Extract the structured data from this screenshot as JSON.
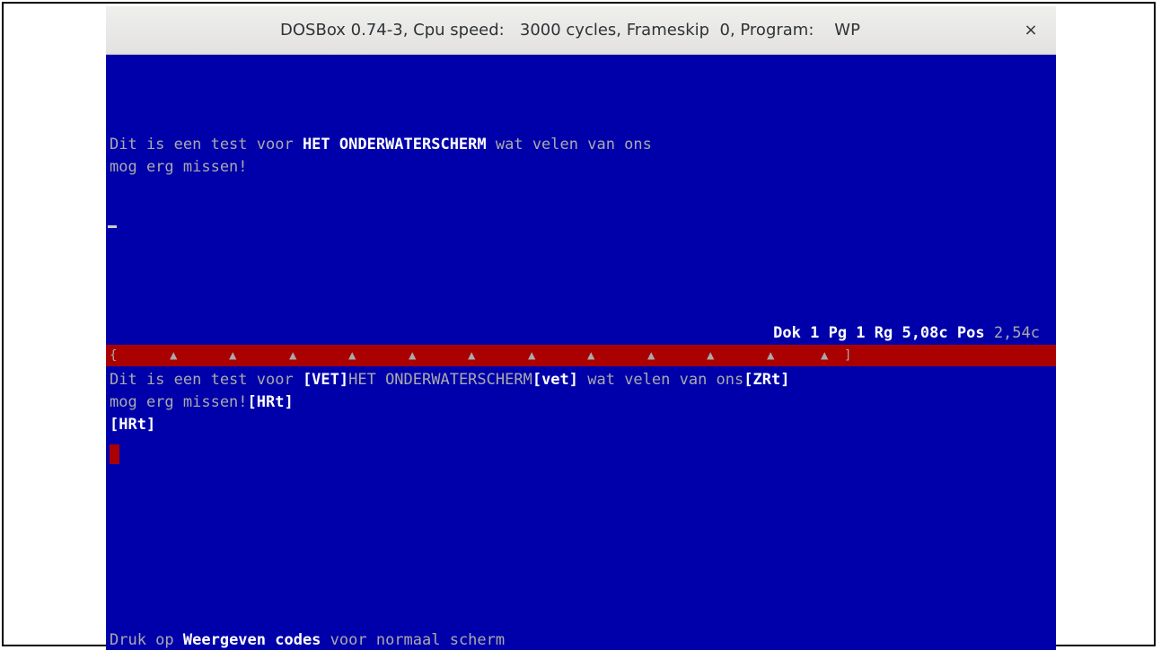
{
  "window": {
    "title": "DOSBox 0.74-3, Cpu speed:   3000 cycles, Frameskip  0, Program:    WP",
    "close_glyph": "×"
  },
  "editor": {
    "line1_pre": "Dit is een test voor ",
    "line1_bold": "HET ONDERWATERSCHERM",
    "line1_post": " wat velen van ons",
    "line2": "mog erg missen!"
  },
  "status": {
    "doc_label": "Dok 1 Pg 1 Rg 5,08c Pos ",
    "pos_value": "2,54c"
  },
  "ruler": {
    "left_bracket": "{",
    "tab_marker": "▲",
    "right_bracket": "]"
  },
  "codes": {
    "line1_a": "Dit is een test voor ",
    "line1_code1": "[VET]",
    "line1_b": "HET ONDERWATERSCHERM",
    "line1_code2": "[vet]",
    "line1_c": " wat velen van ons",
    "line1_code3": "[ZRt]",
    "line2_a": "mog erg missen!",
    "line2_code": "[HRt]",
    "line3_code": "[HRt]"
  },
  "footer": {
    "pre": "Druk op ",
    "key": "Weergeven codes",
    "post": " voor normaal scherm"
  },
  "colors": {
    "background": "#0000aa",
    "ruler": "#aa0000",
    "text": "#aaaaaa",
    "highlight": "#ffffff"
  }
}
